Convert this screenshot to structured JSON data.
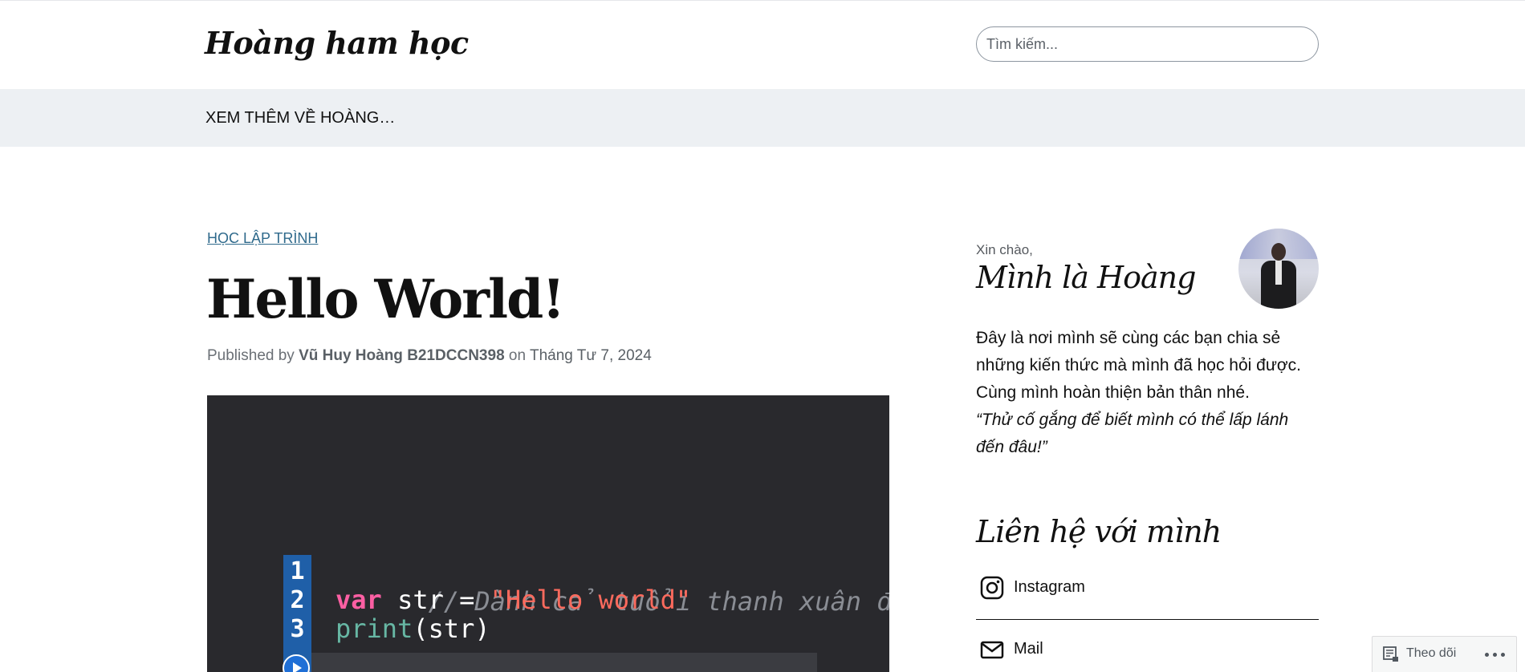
{
  "header": {
    "site_title": "Hoàng ham học",
    "search_placeholder": "Tìm kiếm..."
  },
  "nav": {
    "items": [
      {
        "label": "XEM THÊM VỀ HOÀNG…"
      }
    ]
  },
  "post": {
    "category": "HỌC LẬP TRÌNH",
    "title": "Hello World!",
    "meta": {
      "published_by": "Published by",
      "author": "Vũ Huy Hoàng B21DCCN398",
      "on": "on",
      "date": "Tháng Tư 7, 2024"
    },
    "featured_image": {
      "lines": [
        {
          "num": "1",
          "comment": "// Dành cả tuổi thanh xuân để"
        },
        {
          "num": "2",
          "kw": "var",
          "ident": " str = ",
          "str": "\"Hello world\""
        },
        {
          "num": "3",
          "fn": "print",
          "args": "(str)"
        }
      ]
    }
  },
  "sidebar": {
    "greeting": "Xin chào,",
    "name": "Mình là Hoàng",
    "bio": "Đây là nơi mình sẽ cùng các bạn chia sẻ những kiến thức mà mình đã học hỏi được. Cùng mình hoàn thiện bản thân nhé.",
    "quote": "“Thử cố gắng để biết mình có thể lấp lánh đến đâu!”",
    "contact_heading": "Liên hệ với mình",
    "contacts": [
      {
        "label": "Instagram",
        "icon": "instagram-icon"
      },
      {
        "label": "Mail",
        "icon": "mail-icon"
      }
    ]
  },
  "follow_bar": {
    "follow_label": "Theo dõi",
    "more_icon": "ellipsis-icon"
  },
  "colors": {
    "nav_bg": "#edf0f3",
    "category_link": "#2f6a8c",
    "code_bg": "#29292d"
  }
}
